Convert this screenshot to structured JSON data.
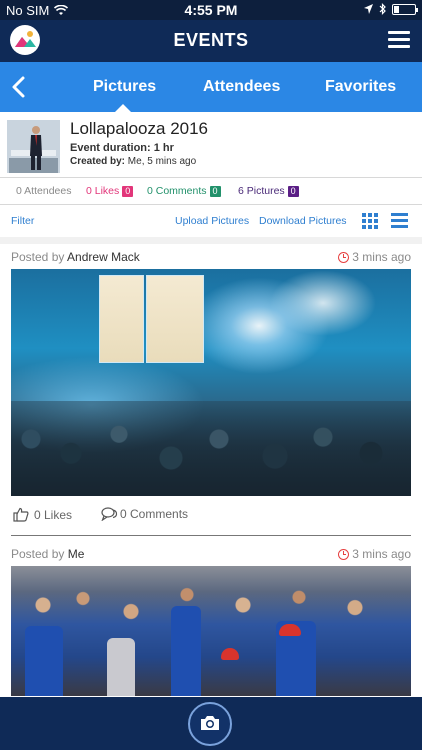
{
  "status_bar": {
    "carrier": "No SIM",
    "time": "4:55 PM",
    "icons": [
      "wifi-icon",
      "location-arrow-icon",
      "bluetooth-icon",
      "battery-icon"
    ]
  },
  "header": {
    "title": "EVENTS",
    "logo": "app-logo-icon",
    "menu_icon": "hamburger-menu-icon",
    "colors": {
      "background": "#0f2a57"
    }
  },
  "tabs": {
    "back_icon": "chevron-left-icon",
    "items": [
      {
        "label": "Pictures",
        "active": true
      },
      {
        "label": "Attendees",
        "active": false
      },
      {
        "label": "Favorites",
        "active": false
      }
    ],
    "colors": {
      "background": "#2b87e5"
    }
  },
  "event": {
    "name": "Lollapalooza 2016",
    "duration": "Event duration: 1 hr",
    "created_by_label": "Created by:",
    "created_by_value": "Me, 5 mins ago"
  },
  "stats": {
    "attendees": "0 Attendees",
    "likes_label": "0 Likes",
    "likes_badge": "0",
    "comments_label": "0 Comments",
    "comments_badge": "0",
    "pictures_label": "6 Pictures",
    "pictures_badge": "0",
    "colors": {
      "likes": "#e2367a",
      "comments": "#22916b",
      "pictures": "#5b1f86"
    }
  },
  "actions": {
    "filter": "Filter",
    "upload": "Upload Pictures",
    "download": "Download Pictures",
    "view_icons": [
      "grid-view-icon",
      "list-view-icon"
    ]
  },
  "posts": [
    {
      "posted_by_label": "Posted by",
      "author": "Andrew Mack",
      "time": "3 mins ago",
      "likes": "0 Likes",
      "comments": "0 Comments"
    },
    {
      "posted_by_label": "Posted by",
      "author": "Me",
      "time": "3 mins ago"
    }
  ],
  "bottom_bar": {
    "camera_icon": "camera-icon"
  }
}
